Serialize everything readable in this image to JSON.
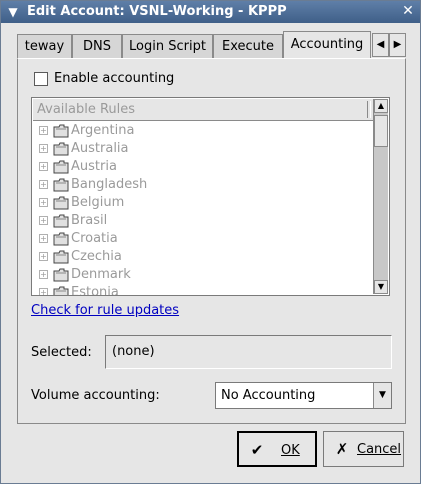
{
  "window": {
    "title": "Edit Account: VSNL-Working - KPPP"
  },
  "tabs": [
    {
      "label": "teway"
    },
    {
      "label": "DNS"
    },
    {
      "label": "Login Script"
    },
    {
      "label": "Execute"
    },
    {
      "label": "Accounting"
    }
  ],
  "accounting": {
    "enable_label": "Enable accounting",
    "enabled": false,
    "rules_header": "Available Rules",
    "rules": [
      {
        "label": "Argentina"
      },
      {
        "label": "Australia"
      },
      {
        "label": "Austria"
      },
      {
        "label": "Bangladesh"
      },
      {
        "label": "Belgium"
      },
      {
        "label": "Brasil"
      },
      {
        "label": "Croatia"
      },
      {
        "label": "Czechia"
      },
      {
        "label": "Denmark"
      },
      {
        "label": "Estonia"
      }
    ],
    "update_link": "Check for rule updates",
    "selected_label": "Selected:",
    "selected_value": "(none)",
    "volume_label": "Volume accounting:",
    "volume_value": "No Accounting"
  },
  "buttons": {
    "ok": "OK",
    "cancel": "Cancel"
  },
  "icons": {
    "menu": "chevron-down-icon",
    "close": "close-icon",
    "tab_left": "arrow-left-icon",
    "tab_right": "arrow-right-icon",
    "folder": "folder-icon",
    "ok": "checkmark-icon",
    "cancel": "cancel-icon"
  },
  "colors": {
    "titlebar": "#4f6f98",
    "link": "#0000c0",
    "disabled_text": "#9a9a9a"
  }
}
